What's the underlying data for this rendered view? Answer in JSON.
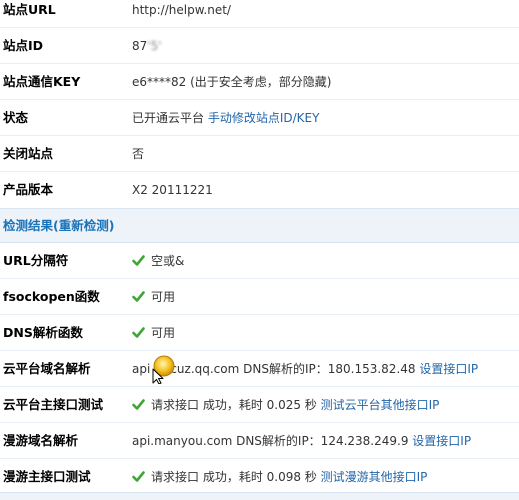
{
  "site": {
    "url_label": "站点URL",
    "url_value": "http://helpw.net/",
    "id_label": "站点ID",
    "id_value": "87",
    "id_blurred": "'5'",
    "key_label": "站点通信KEY",
    "key_value": "e6****82 (出于安全考虑，部分隐藏)",
    "status_label": "状态",
    "status_value": "已开通云平台 ",
    "status_link": "手动修改站点ID/KEY",
    "closed_label": "关闭站点",
    "closed_value": "否",
    "version_label": "产品版本",
    "version_value": "X2 20111221"
  },
  "section": {
    "title": "检测结果(重新检测)"
  },
  "checks": {
    "url_sep_label": "URL分隔符",
    "url_sep_value": "空或&",
    "fsock_label": "fsockopen函数",
    "fsock_value": "可用",
    "dns_label": "DNS解析函数",
    "dns_value": "可用",
    "cloud_domain_label": "云平台域名解析",
    "cloud_domain_prefix": "api",
    "cloud_domain_value": "cuz.qq.com DNS解析的IP：180.153.82.48 ",
    "cloud_domain_link": "设置接口IP",
    "cloud_api_label": "云平台主接口测试",
    "cloud_api_value": "请求接口 成功，耗时 0.025 秒 ",
    "cloud_api_link": "测试云平台其他接口IP",
    "manyou_domain_label": "漫游域名解析",
    "manyou_domain_value": "api.manyou.com DNS解析的IP：124.238.249.9 ",
    "manyou_domain_link": "设置接口IP",
    "manyou_api_label": "漫游主接口测试",
    "manyou_api_value": "请求接口 成功，耗时 0.098 秒 ",
    "manyou_api_link": "测试漫游其他接口IP"
  },
  "colors": {
    "link": "#2366a8",
    "section_bg": "#eef3fa",
    "section_title": "#1b73b8",
    "check": "#3fa535"
  },
  "icons": {
    "check": "check-icon",
    "cursor": "cursor-icon"
  }
}
